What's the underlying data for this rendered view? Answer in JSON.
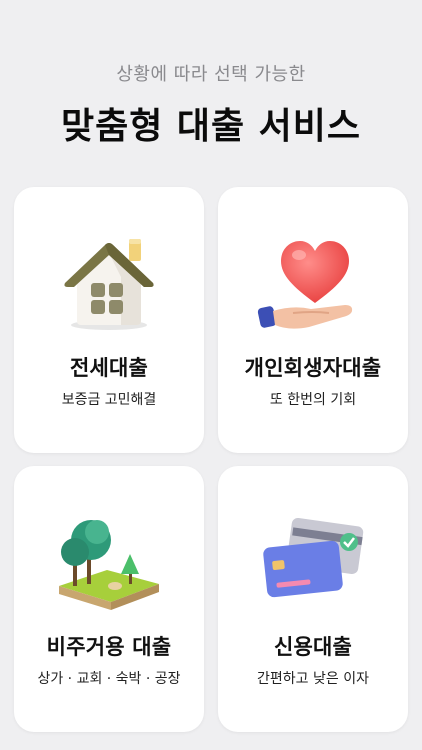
{
  "header": {
    "subtitle": "상황에 따라 선택 가능한",
    "title": "맞춤형 대출 서비스"
  },
  "cards": [
    {
      "name": "전세대출",
      "desc": "보증금 고민해결",
      "icon": "house-icon"
    },
    {
      "name": "개인회생자대출",
      "desc": "또 한번의 기회",
      "icon": "heart-hand-icon"
    },
    {
      "name": "비주거용 대출",
      "desc": "상가 · 교회 · 숙박 · 공장",
      "icon": "trees-land-icon"
    },
    {
      "name": "신용대출",
      "desc": "간편하고 낮은 이자",
      "icon": "credit-card-icon"
    }
  ],
  "colors": {
    "background": "#efeff1",
    "card": "#ffffff",
    "subtitle": "#8a8a8e",
    "title": "#0b0b0b"
  }
}
